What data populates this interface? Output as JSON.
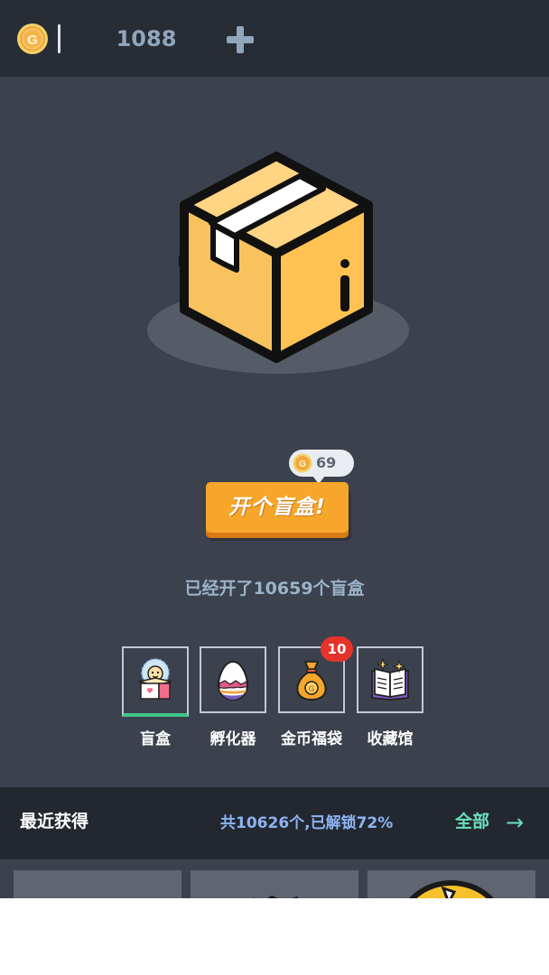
{
  "topbar": {
    "coin_icon_name": "gold-coin-icon",
    "coin_count": "1088",
    "add_icon_name": "plus-icon"
  },
  "box": {
    "icon_name": "cardboard-box-icon"
  },
  "open": {
    "price": "69",
    "button_label": "开个盲盒!"
  },
  "stats": {
    "opened_text": "已经开了10659个盲盒"
  },
  "nav": {
    "items": [
      {
        "label": "盲盒",
        "icon": "surprise-box-icon"
      },
      {
        "label": "孵化器",
        "icon": "egg-icon"
      },
      {
        "label": "金币福袋",
        "icon": "money-bag-icon",
        "badge": "10"
      },
      {
        "label": "收藏馆",
        "icon": "book-icon"
      }
    ]
  },
  "recent": {
    "title": "最近获得",
    "summary": "共10626个,已解锁72%",
    "all_label": "全部",
    "arrow": "→"
  },
  "colors": {
    "background": "#3b414d",
    "topbar": "#272c35",
    "button": "#f6a62b",
    "active_tab_underline": "#42c58b",
    "badge": "#e5332b",
    "link": "#6ce0bf"
  }
}
